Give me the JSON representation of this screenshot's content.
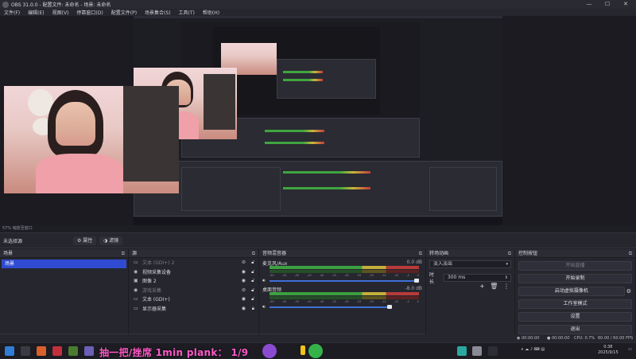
{
  "window": {
    "title": "OBS 31.0.0 - 配置文件: 未命名 - 场景: 未命名",
    "minimize": "—",
    "maximize": "☐",
    "close": "✕"
  },
  "menu": [
    "文件(F)",
    "编辑(E)",
    "视图(V)",
    "停靠窗口(D)",
    "配置文件(P)",
    "场景集合(S)",
    "工具(T)",
    "帮助(H)"
  ],
  "zoom_label": "57%  缩放至窗口",
  "scene_info": {
    "no_scene": "未选择源",
    "properties": "属性",
    "filters": "滤镜"
  },
  "docks": {
    "scenes": {
      "title": "场景",
      "items": [
        "场景"
      ]
    },
    "sources": {
      "title": "源",
      "items": [
        {
          "icon": "▭",
          "label": "文本 (GDI+) 2",
          "dim": true
        },
        {
          "icon": "◉",
          "label": "视频采集设备",
          "dim": false
        },
        {
          "icon": "▣",
          "label": "图像 2",
          "dim": false
        },
        {
          "icon": "◉",
          "label": "游戏采集",
          "dim": true
        },
        {
          "icon": "▭",
          "label": "文本 (GDI+)",
          "dim": false
        },
        {
          "icon": "▭",
          "label": "显示器采集",
          "dim": false
        }
      ]
    },
    "mixer": {
      "title": "音频混音器",
      "channels": [
        {
          "name": "麦克风/Aux",
          "db": "0.0 dB",
          "active": true,
          "volume": 1.0
        },
        {
          "name": "桌面音频",
          "db": "-8.0 dB",
          "active": true,
          "volume": 0.82
        }
      ],
      "scale": [
        "-60",
        "-55",
        "-50",
        "-45",
        "-40",
        "-35",
        "-30",
        "-25",
        "-20",
        "-15",
        "-10",
        "-5",
        "0"
      ]
    },
    "transitions": {
      "title": "转场动画",
      "selected": "淡入淡出",
      "duration_label": "时长",
      "duration_value": "300 ms"
    },
    "controls": {
      "title": "控制按钮",
      "buttons": [
        {
          "label": "开始直播",
          "disabled": true
        },
        {
          "label": "开始录制",
          "disabled": false
        },
        {
          "label": "启动虚拟摄像机",
          "disabled": false
        },
        {
          "label": "工作室模式",
          "disabled": false
        },
        {
          "label": "设置",
          "disabled": false
        },
        {
          "label": "退出",
          "disabled": false
        }
      ]
    }
  },
  "status": {
    "net": "00:00:00",
    "rec": "00:00:00",
    "cpu": "CPU: 0.7%",
    "fps": "60.00 / 60.00 FPS"
  },
  "taskbar": {
    "banner": "抽一把/挫席 1min plank： 1/9",
    "time": "0:38",
    "date": "2025/9/15"
  },
  "colors": {
    "accent": "#2f4bd1",
    "banner": "#ff5ac8",
    "meter_green": "#3ca040",
    "meter_yellow": "#c4b03a",
    "meter_red": "#b83a3a"
  }
}
